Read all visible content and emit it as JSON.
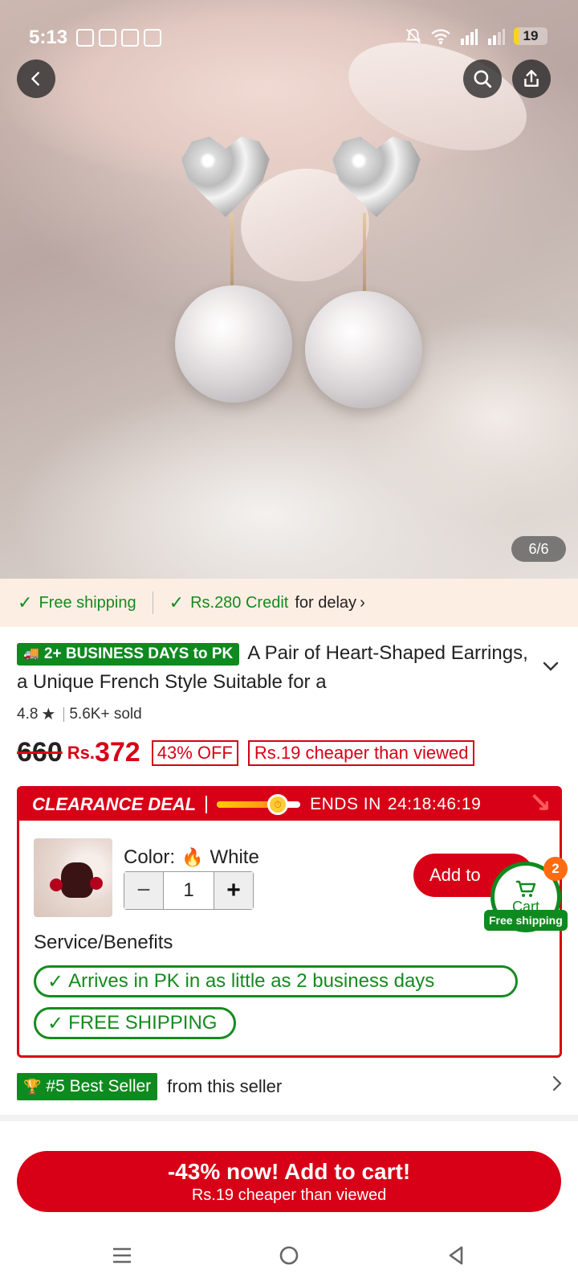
{
  "status_bar": {
    "time": "5:13",
    "battery": "19"
  },
  "hero": {
    "image_counter": "6/6",
    "icons": [
      "back-arrow-icon",
      "search-icon",
      "share-icon"
    ]
  },
  "shipping_strip": {
    "free_shipping": "Free shipping",
    "credit": "Rs.280 Credit",
    "credit_suffix": "for delay",
    "chevron": "›"
  },
  "product": {
    "days_badge": "2+ BUSINESS DAYS to PK",
    "title": "A Pair of Heart-Shaped Earrings, a Unique French Style Suitable for a",
    "rating": "4.8",
    "sold": "5.6K+ sold",
    "old_price": "660",
    "currency": "Rs.",
    "price": "372",
    "discount": "43% OFF",
    "cheaper": "Rs.19 cheaper than viewed"
  },
  "clearance": {
    "title": "CLEARANCE DEAL",
    "progress_fraction": 0.73,
    "ends_in_label": "ENDS IN",
    "countdown": "24:18:46:19",
    "color_label": "Color:",
    "color_value": "White",
    "quantity": "1",
    "add_button": "Add to",
    "service_title": "Service/Benefits",
    "benefits": [
      "Arrives in PK in as little as 2 business days",
      "FREE SHIPPING"
    ]
  },
  "cart": {
    "label": "Cart",
    "count": "2",
    "free_shipping": "Free shipping"
  },
  "best_seller": {
    "badge": "#5 Best Seller",
    "text": "from this seller"
  },
  "cta": {
    "main": "-43% now! Add to cart!",
    "sub": "Rs.19 cheaper than viewed"
  },
  "colors": {
    "brand_red": "#d80016",
    "green": "#0f8a1f",
    "shipping_bg": "#fdeee4"
  }
}
